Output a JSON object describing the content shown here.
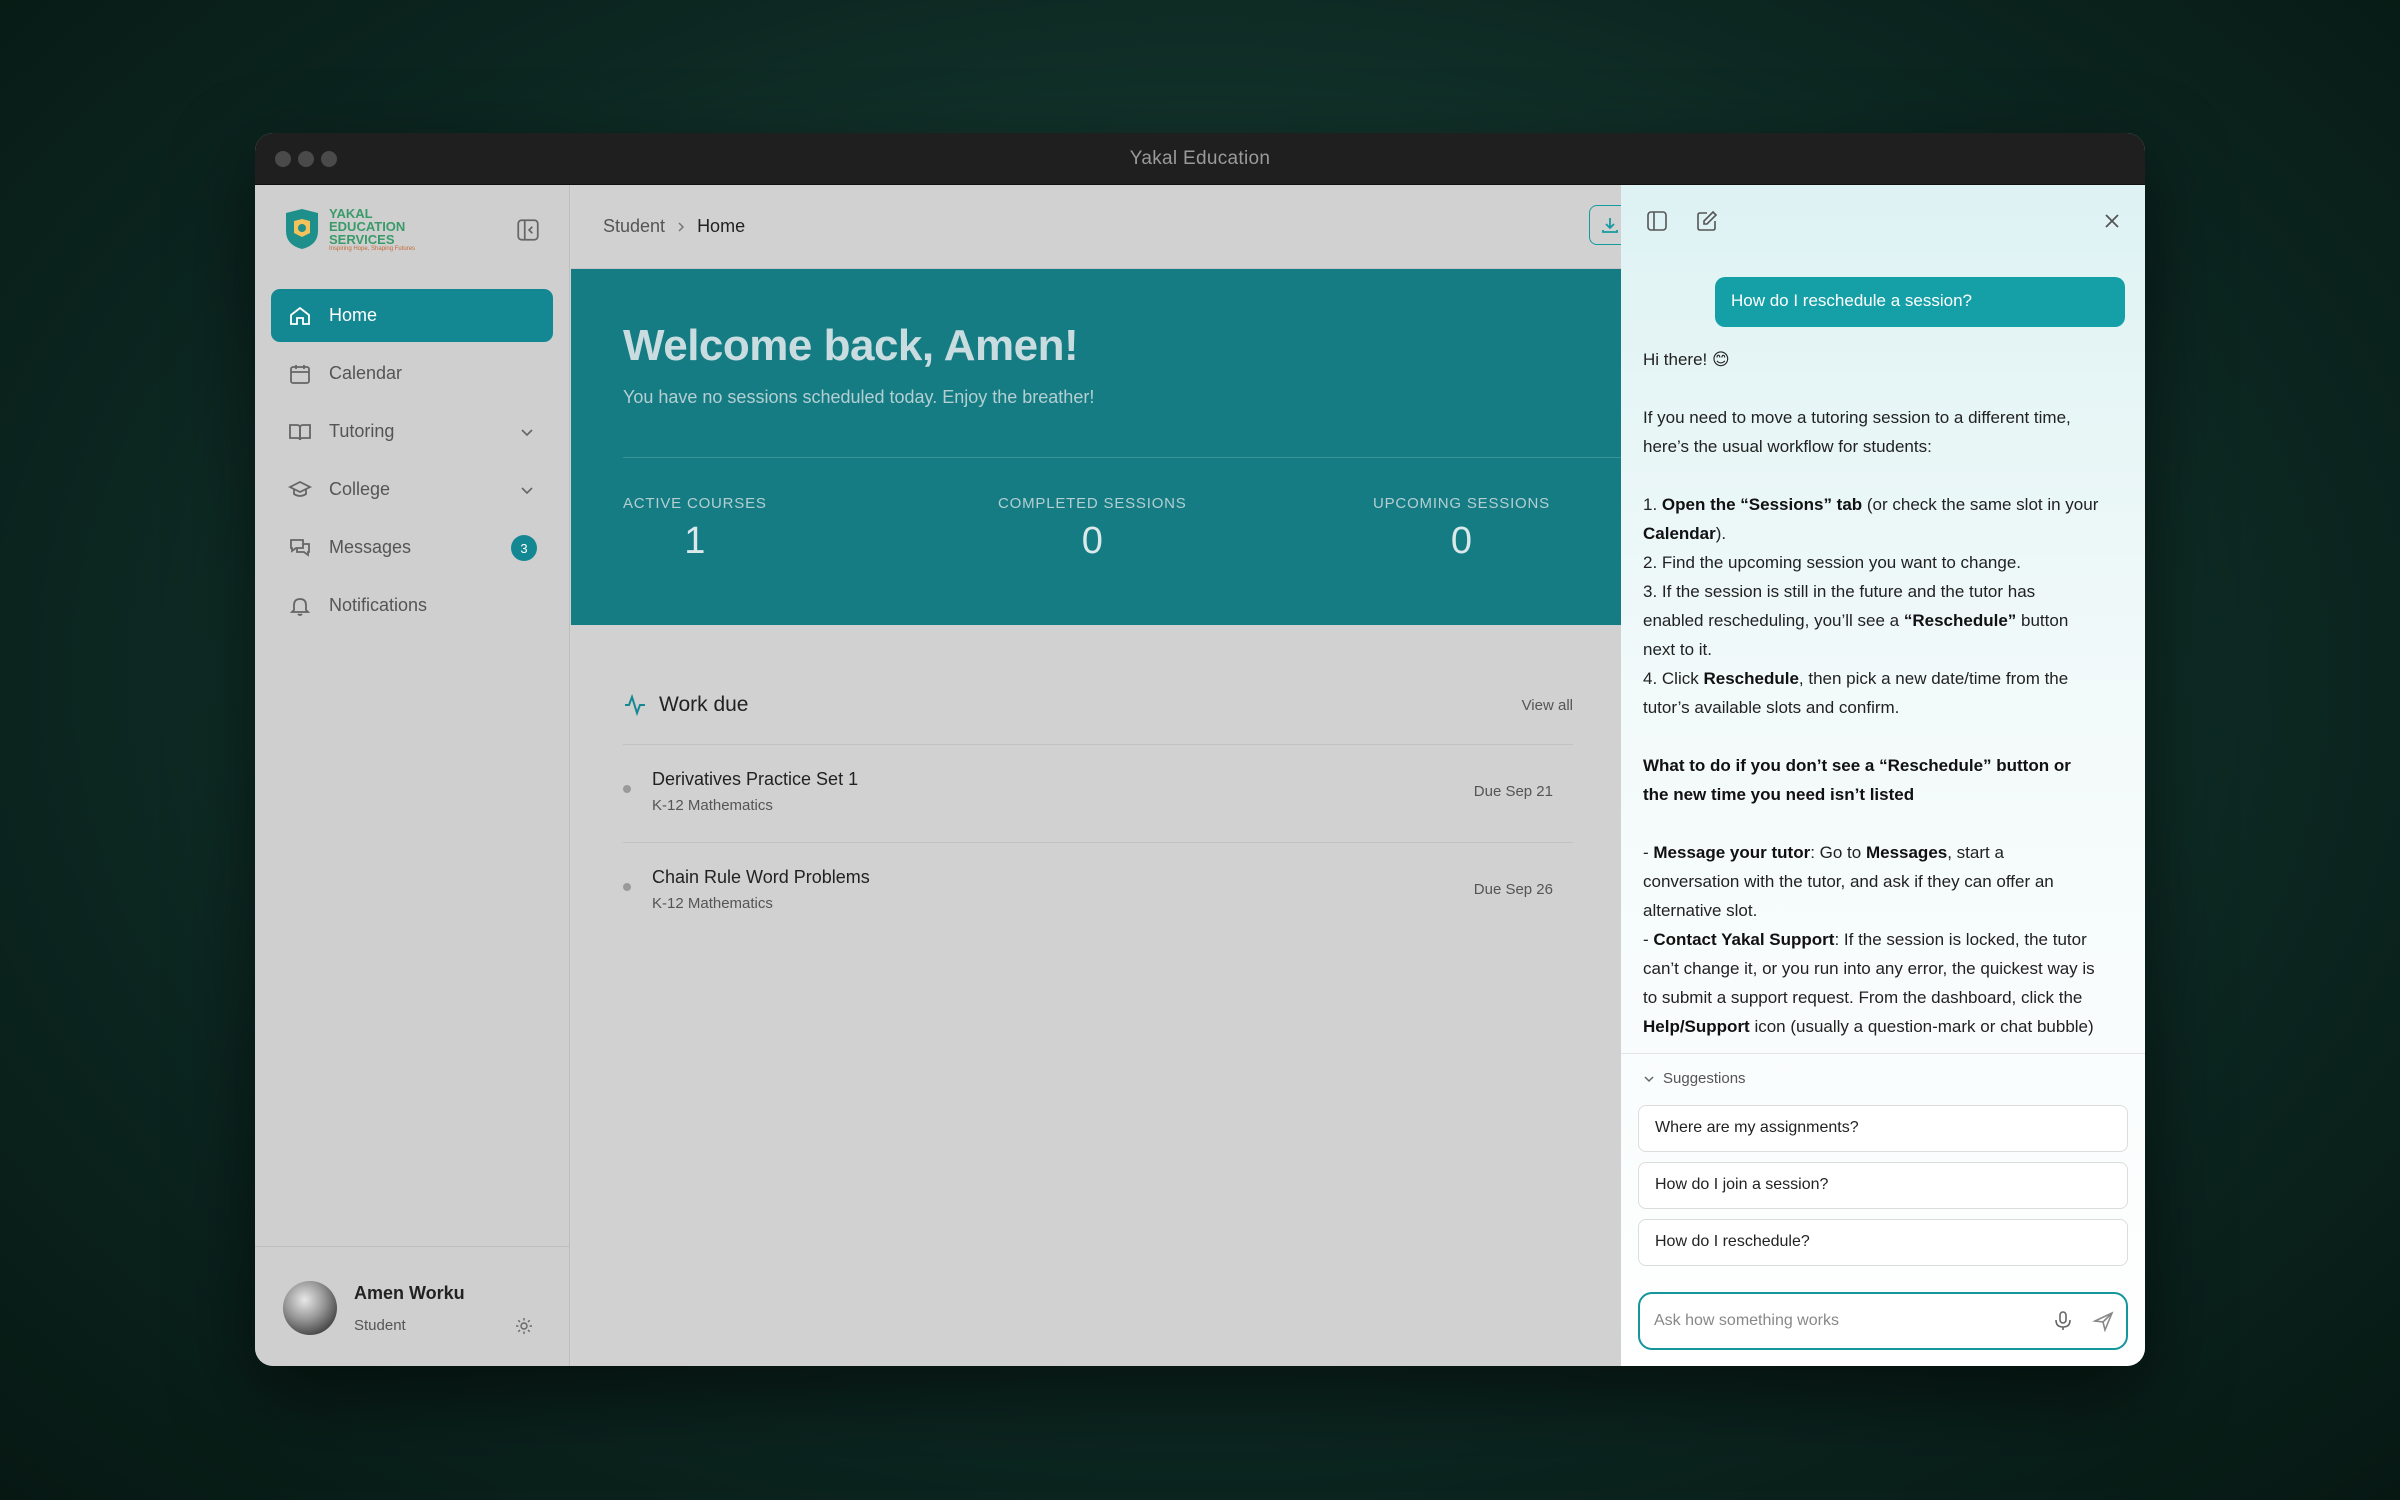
{
  "window": {
    "title": "Yakal Education"
  },
  "logo": {
    "line1": "YAKAL",
    "line2": "EDUCATION",
    "line3": "SERVICES",
    "tagline": "Inspiring Hope, Shaping Futures"
  },
  "sidebar": {
    "items": [
      {
        "label": "Home",
        "icon": "home-icon",
        "active": true
      },
      {
        "label": "Calendar",
        "icon": "calendar-icon"
      },
      {
        "label": "Tutoring",
        "icon": "book-icon",
        "expandable": true
      },
      {
        "label": "College",
        "icon": "graduation-cap-icon",
        "expandable": true
      },
      {
        "label": "Messages",
        "icon": "chat-icon",
        "badge": "3"
      },
      {
        "label": "Notifications",
        "icon": "bell-icon"
      }
    ]
  },
  "user": {
    "name": "Amen Worku",
    "role": "Student"
  },
  "breadcrumb": {
    "parent": "Student",
    "current": "Home"
  },
  "hero": {
    "title": "Welcome back, Amen!",
    "subtitle": "You have no sessions scheduled today. Enjoy the breather!",
    "stats": [
      {
        "label": "ACTIVE COURSES",
        "value": "1"
      },
      {
        "label": "COMPLETED SESSIONS",
        "value": "0"
      },
      {
        "label": "UPCOMING SESSIONS",
        "value": "0"
      }
    ]
  },
  "work_due": {
    "title": "Work due",
    "view_all": "View all",
    "items": [
      {
        "name": "Derivatives Practice Set 1",
        "course": "K-12 Mathematics",
        "due": "Due Sep 21"
      },
      {
        "name": "Chain Rule Word Problems",
        "course": "K-12 Mathematics",
        "due": "Due Sep 26"
      }
    ]
  },
  "chat": {
    "user_message": "How do I reschedule a session?",
    "reply": {
      "greeting": "Hi there! 😊",
      "intro": "If you need to move a tutoring session to a different time, here’s the usual workflow for students:",
      "step1_num": "1. ",
      "step1_bold": "Open the “Sessions” tab",
      "step1_mid": " (or check the same slot in your ",
      "step1_bold2": "Calendar",
      "step1_end": ").",
      "step2": "2. Find the upcoming session you want to change.",
      "step3_start": "3. If the session is still in the future and the tutor has enabled rescheduling, you’ll see a ",
      "step3_bold": "“Reschedule”",
      "step3_end": " button next to it.",
      "step4_start": "4. Click ",
      "step4_bold": "Reschedule",
      "step4_end": ", then pick a new date/time from the tutor’s available slots and confirm.",
      "heading": "What to do if you don’t see a “Reschedule” button or the new time you need isn’t listed",
      "b1_dash": "- ",
      "b1_bold": "Message your tutor",
      "b1_mid": ": Go to ",
      "b1_bold2": "Messages",
      "b1_end": ", start a conversation with the tutor, and ask if they can offer an alternative slot.",
      "b2_dash": "- ",
      "b2_bold": "Contact Yakal Support",
      "b2_mid": ": If the session is locked, the tutor can’t change it, or you run into any error, the quickest way is to submit a support request. From the dashboard, click the ",
      "b2_bold2": "Help/Support",
      "b2_end": " icon (usually a question-mark or chat bubble) and choose “Reschedule a session.” Include the"
    },
    "suggestions_label": "Suggestions",
    "suggestions": [
      "Where are my assignments?",
      "How do I join a session?",
      "How do I reschedule?"
    ],
    "input_placeholder": "Ask how something works"
  }
}
